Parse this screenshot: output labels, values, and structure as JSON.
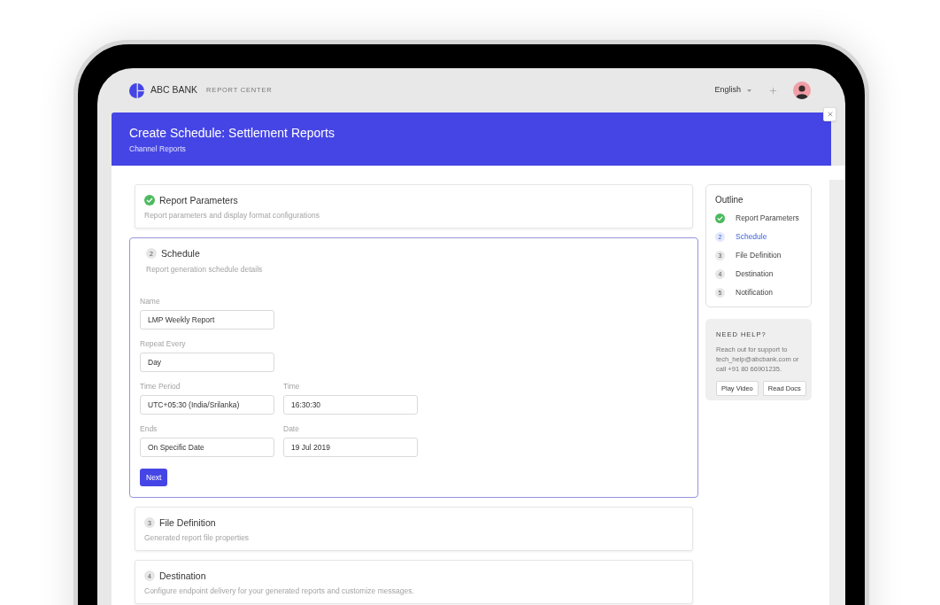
{
  "header": {
    "brand": "ABC BANK",
    "product": "REPORT CENTER",
    "language": "English"
  },
  "banner": {
    "title": "Create Schedule: Settlement Reports",
    "subtitle": "Channel Reports"
  },
  "steps": [
    {
      "title": "Report Parameters",
      "description": "Report parameters and display format configurations",
      "completed": true,
      "expanded": false
    },
    {
      "number": "2",
      "title": "Schedule",
      "description": "Report generation schedule details",
      "completed": false,
      "expanded": true,
      "form": {
        "rows": [
          [
            {
              "label": "Name",
              "value": "LMP Weekly Report"
            }
          ],
          [
            {
              "label": "Repeat Every",
              "value": "Day"
            }
          ],
          [
            {
              "label": "Time Period",
              "value": "UTC+05:30 (India/Srilanka)"
            },
            {
              "label": "Time",
              "value": "16:30:30"
            }
          ],
          [
            {
              "label": "Ends",
              "value": "On Specific Date"
            },
            {
              "label": "Date",
              "value": "19 Jul 2019"
            }
          ]
        ],
        "next_button": "Next"
      }
    },
    {
      "number": "3",
      "title": "File Definition",
      "description": "Generated report file properties",
      "completed": false,
      "expanded": false
    },
    {
      "number": "4",
      "title": "Destination",
      "description": "Configure endpoint delivery for your generated reports and customize messages.",
      "completed": false,
      "expanded": false
    }
  ],
  "outline": {
    "title": "Outline",
    "items": [
      {
        "label": "Report Parameters",
        "completed": true,
        "selected": false
      },
      {
        "number": "2",
        "label": "Schedule",
        "completed": false,
        "selected": true
      },
      {
        "number": "3",
        "label": "File Definition",
        "completed": false,
        "selected": false
      },
      {
        "number": "4",
        "label": "Destination",
        "completed": false,
        "selected": false
      },
      {
        "number": "5",
        "label": "Notification",
        "completed": false,
        "selected": false
      }
    ]
  },
  "help": {
    "title": "NEED HELP?",
    "text": "Reach out for support to tech_help@abcbank.com or call +91 80 66901235.",
    "buttons": [
      "Play Video",
      "Read Docs"
    ]
  }
}
